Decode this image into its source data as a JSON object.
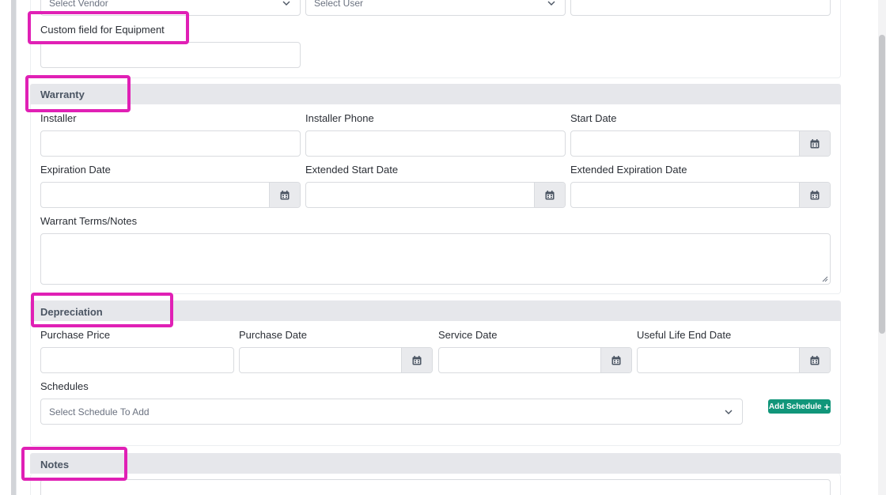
{
  "top_row": {
    "vendor_select": "Select Vendor",
    "user_select": "Select User"
  },
  "custom_field": {
    "label": "Custom field for Equipment"
  },
  "warranty": {
    "title": "Warranty",
    "installer_label": "Installer",
    "installer_phone_label": "Installer Phone",
    "start_date_label": "Start Date",
    "expiration_date_label": "Expiration Date",
    "extended_start_date_label": "Extended Start Date",
    "extended_expiration_date_label": "Extended Expiration Date",
    "terms_label": "Warrant Terms/Notes"
  },
  "depreciation": {
    "title": "Depreciation",
    "purchase_price_label": "Purchase Price",
    "purchase_date_label": "Purchase Date",
    "service_date_label": "Service Date",
    "useful_life_end_label": "Useful Life End Date",
    "schedules_label": "Schedules",
    "schedule_select": "Select Schedule To Add",
    "add_schedule_label": "Add Schedule"
  },
  "notes": {
    "title": "Notes"
  },
  "colors": {
    "highlight": "#e020b5",
    "accent": "#11967a",
    "section_bg": "#e6e7eb"
  },
  "icons": {
    "calendar": "calendar-icon",
    "chevron": "chevron-down-icon",
    "plus": "plus-icon"
  }
}
